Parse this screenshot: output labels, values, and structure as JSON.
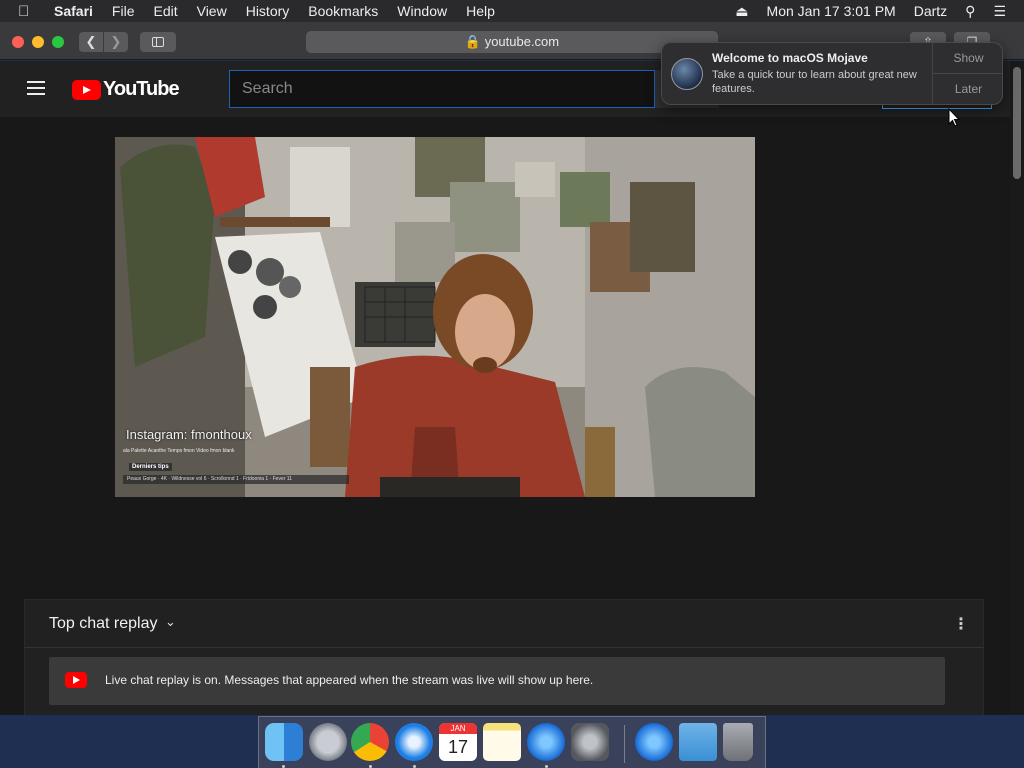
{
  "menubar": {
    "app": "Safari",
    "items": [
      "File",
      "Edit",
      "View",
      "History",
      "Bookmarks",
      "Window",
      "Help"
    ],
    "datetime": "Mon Jan 17  3:01 PM",
    "user": "Dartz",
    "icons": [
      "apple-icon",
      "eject-icon",
      "search-icon",
      "menu-list-icon"
    ]
  },
  "browser": {
    "url": "youtube.com"
  },
  "youtube": {
    "logo_text": "YouTube",
    "search_placeholder": "Search",
    "video_overlay_text": "Instagram: fmonthoux",
    "video_tips_label": "Derniers tips",
    "video_ticker": "Peaux Gorge · 4K · Wildnesse vol 6 · Scrollonnd 1 · Fridoonia 1 · Fever 11",
    "video_links": "ala Palette   Acanthe Temps   fmon Video   fmon blank"
  },
  "chat": {
    "title": "Top chat replay",
    "banner": "Live chat replay is on. Messages that appeared when the stream was live will show up here."
  },
  "notification": {
    "title": "Welcome to macOS Mojave",
    "body": "Take a quick tour to learn about great new features.",
    "actions": [
      "Show",
      "Later"
    ]
  },
  "dock": {
    "apps": [
      "Finder",
      "Launchpad",
      "Chrome",
      "Safari",
      "Calendar",
      "Notes",
      "App Store",
      "System Preferences",
      "App Store",
      "Downloads",
      "Trash"
    ],
    "calendar_month": "JAN",
    "calendar_day": "17"
  },
  "colors": {
    "youtube_red": "#ff0000",
    "search_border": "#1c62b9",
    "page_bg": "#181818",
    "desktop": "#1e2f52"
  }
}
